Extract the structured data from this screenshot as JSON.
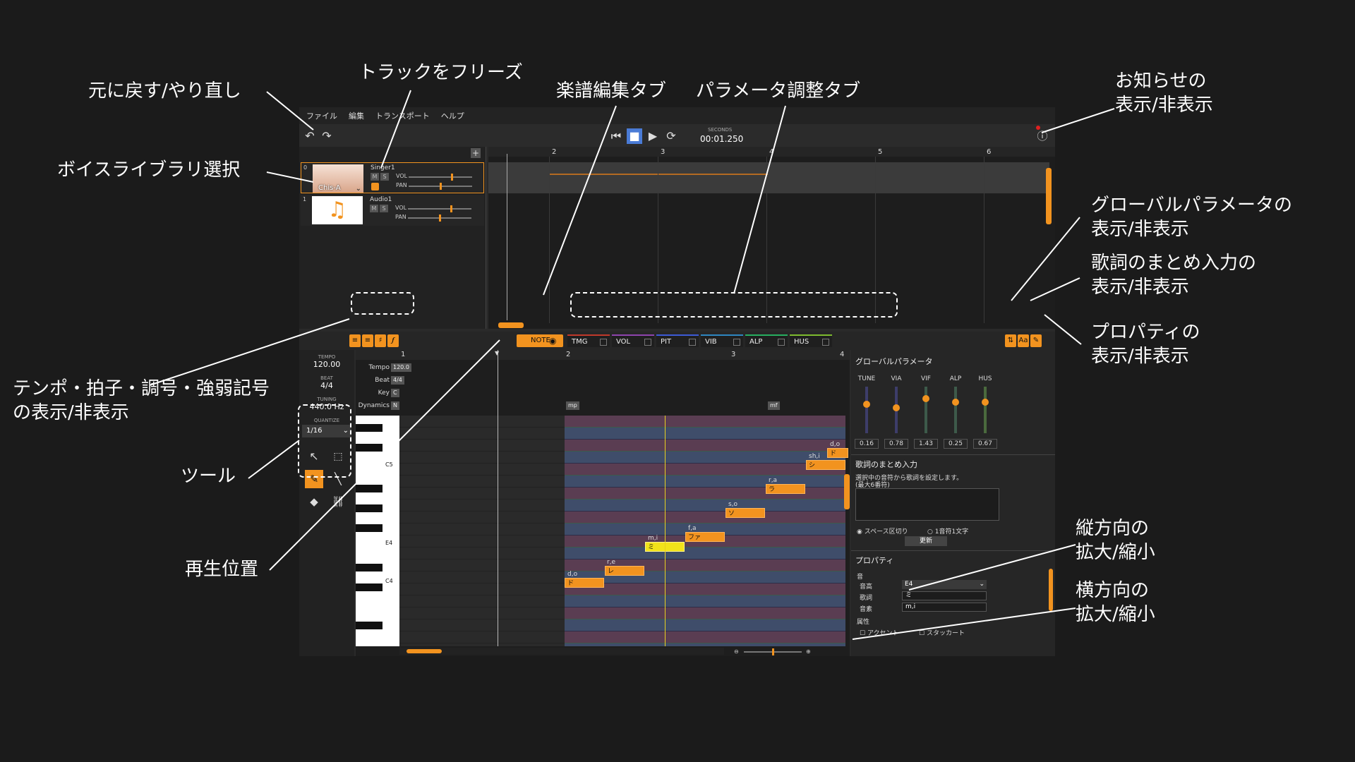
{
  "annotations": {
    "undo_redo": "元に戻す/やり直し",
    "freeze_track": "トラックをフリーズ",
    "score_tab": "楽譜編集タブ",
    "param_tab": "パラメータ調整タブ",
    "notice_l1": "お知らせの",
    "notice_l2": "表示/非表示",
    "voice_library": "ボイスライブラリ選択",
    "global_l1": "グローバルパラメータの",
    "global_l2": "表示/非表示",
    "lyrics_l1": "歌詞のまとめ入力の",
    "lyrics_l2": "表示/非表示",
    "tempo_l1": "テンポ・拍子・調号・強弱記号",
    "tempo_l2": "の表示/非表示",
    "props_l1": "プロパティの",
    "props_l2": "表示/非表示",
    "tools": "ツール",
    "playhead": "再生位置",
    "vzoom_l1": "縦方向の",
    "vzoom_l2": "拡大/縮小",
    "hzoom_l1": "横方向の",
    "hzoom_l2": "拡大/縮小"
  },
  "menu": [
    "ファイル",
    "編集",
    "トランスポート",
    "ヘルプ"
  ],
  "transport": {
    "seconds_label": "SECONDS",
    "time": "00:01.250"
  },
  "tracks": [
    {
      "index": "0",
      "name": "Singer1",
      "voice": "Chis-A",
      "vol": "VOL",
      "pan": "PAN"
    },
    {
      "index": "1",
      "name": "Audio1",
      "vol": "VOL",
      "pan": "PAN"
    }
  ],
  "arrange_ruler": [
    "2",
    "3",
    "4",
    "5",
    "6"
  ],
  "tabs": {
    "note": "NOTE",
    "params": [
      "TMG",
      "VOL",
      "PIT",
      "VIB",
      "ALP",
      "HUS"
    ]
  },
  "left_panel": {
    "tempo_label": "TEMPO",
    "tempo": "120.00",
    "beat_label": "BEAT",
    "beat": "4/4",
    "tuning_label": "TUNING",
    "tuning": "440.0 Hz",
    "quantize_label": "QUANTIZE",
    "quantize": "1/16"
  },
  "editor": {
    "ruler": [
      "1",
      "2",
      "3",
      "4"
    ],
    "rows": [
      {
        "label": "Tempo",
        "value": "120.0"
      },
      {
        "label": "Beat",
        "value": "4/4"
      },
      {
        "label": "Key",
        "value": "C"
      },
      {
        "label": "Dynamics",
        "value": "N"
      }
    ],
    "dynamics": [
      "mp",
      "mf"
    ],
    "octaves": [
      "C5",
      "E4",
      "C4"
    ],
    "notes": [
      {
        "lyric": "ド",
        "phoneme": "d,o"
      },
      {
        "lyric": "レ",
        "phoneme": "r,e"
      },
      {
        "lyric": "ミ",
        "phoneme": "m,i"
      },
      {
        "lyric": "ファ",
        "phoneme": "f,a"
      },
      {
        "lyric": "ソ",
        "phoneme": "s,o"
      },
      {
        "lyric": "ラ",
        "phoneme": "r,a"
      },
      {
        "lyric": "シ",
        "phoneme": "sh,i"
      },
      {
        "lyric": "ド",
        "phoneme": "d,o"
      }
    ]
  },
  "global_params": {
    "title": "グローバルパラメータ",
    "items": [
      {
        "name": "TUNE",
        "value": "0.16",
        "level": 0.16
      },
      {
        "name": "VIA",
        "value": "0.78",
        "level": 0.78
      },
      {
        "name": "VIF",
        "value": "1.43",
        "level": 1.43
      },
      {
        "name": "ALP",
        "value": "0.25",
        "level": 0.25
      },
      {
        "name": "HUS",
        "value": "0.67",
        "level": 0.67
      }
    ]
  },
  "lyrics_input": {
    "title": "歌詞のまとめ入力",
    "desc1": "選択中の音符から歌詞を設定します。",
    "desc2": "(最大6番符)",
    "opt_space": "スペース区切り",
    "opt_char": "1音符1文字",
    "update": "更新"
  },
  "properties": {
    "title": "プロパティ",
    "group_note": "音",
    "pitch_label": "音高",
    "pitch": "E4",
    "lyric_label": "歌詞",
    "lyric": "ミ",
    "phoneme_label": "音素",
    "phoneme": "m,i",
    "attr_label": "属性",
    "accent": "アクセント",
    "staccato": "スタッカート"
  },
  "colors": {
    "accent": "#f2931f",
    "playhead": "#e8d020"
  }
}
